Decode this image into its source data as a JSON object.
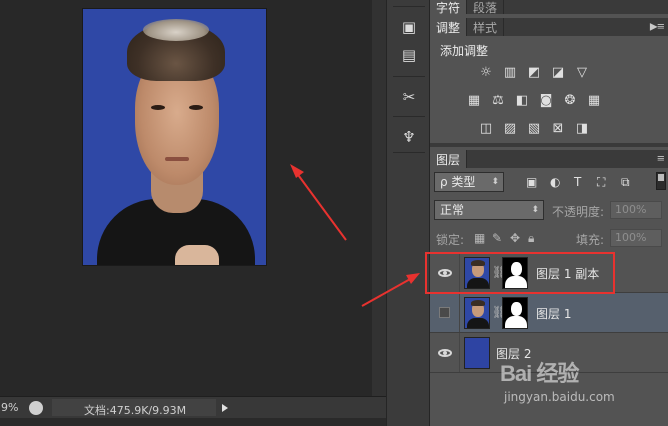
{
  "panels": {
    "character_tabs": [
      "字符",
      "段落"
    ],
    "adjustments_tabs": [
      "调整",
      "样式"
    ],
    "adjustments_title": "添加调整",
    "layers_tab": "图层"
  },
  "layers_controls": {
    "filter_kind": "ρ 类型",
    "blend_mode": "正常",
    "opacity_label": "不透明度:",
    "opacity_value": "100%",
    "lock_label": "锁定:",
    "fill_label": "填充:",
    "fill_value": "100%"
  },
  "layers": [
    {
      "name": "图层 1 副本",
      "visible": true,
      "selected": false,
      "has_mask": true
    },
    {
      "name": "图层 1",
      "visible": false,
      "selected": true,
      "has_mask": true
    },
    {
      "name": "图层 2",
      "visible": true,
      "selected": false,
      "has_mask": false
    }
  ],
  "status": {
    "zoom": "9%",
    "doc_info": "文档:475.9K/9.93M"
  },
  "watermark": {
    "logo": "Bai 经验",
    "site": "jingyan.baidu.com"
  },
  "colors": {
    "canvas_bg": "#282828",
    "panel_bg": "#535353",
    "photo_bg": "#2f48a6",
    "selected_layer": "#56606d",
    "annotation_red": "#e8322f"
  },
  "icons": {
    "adjustments": [
      "brightness-icon",
      "levels-icon",
      "curves-icon",
      "exposure-icon",
      "vibrance-icon",
      "hue-saturation-icon",
      "color-balance-icon",
      "black-white-icon",
      "photo-filter-icon",
      "channel-mixer-icon",
      "color-lookup-icon",
      "invert-icon",
      "posterize-icon",
      "threshold-icon",
      "gradient-map-icon",
      "selective-color-icon"
    ]
  }
}
